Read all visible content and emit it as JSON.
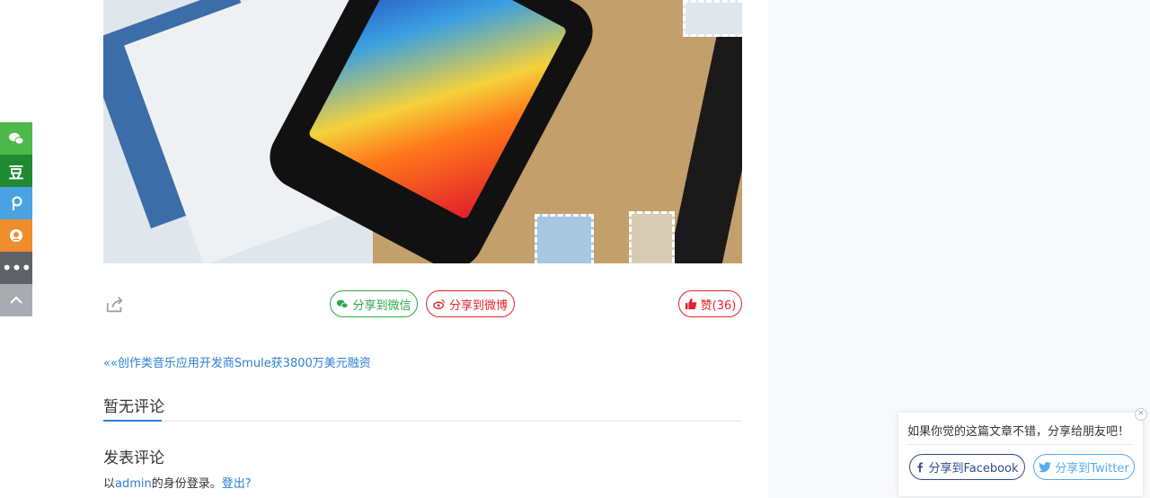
{
  "actions": {
    "wechat_label": "分享到微信",
    "weibo_label": "分享到微博",
    "like_label": "赞(36)"
  },
  "nav": {
    "prev_prefix": "««",
    "prev_title": "创作类音乐应用开发商Smule获3800万美元融资"
  },
  "comments": {
    "title": "暂无评论",
    "post_title": "发表评论",
    "login_prefix": "以",
    "login_user": "admin",
    "login_middle": "的身份登录。",
    "logout_label": "登出?"
  },
  "sidebar": {
    "douban_glyph": "豆",
    "more_glyph": "•••",
    "items": [
      "wechat-icon",
      "douban-icon",
      "p-icon",
      "qzone-icon",
      "more-icon",
      "up-icon"
    ]
  },
  "popup": {
    "text": "如果你觉的这篇文章不错，分享给朋友吧！",
    "close": "×",
    "facebook_label": "分享到Facebook",
    "twitter_label": "分享到Twitter"
  },
  "colors": {
    "accent": "#2b7fd4",
    "wechat": "#2aa84a",
    "weibo": "#e0232e",
    "facebook": "#2d4d8c",
    "twitter": "#55acee"
  }
}
